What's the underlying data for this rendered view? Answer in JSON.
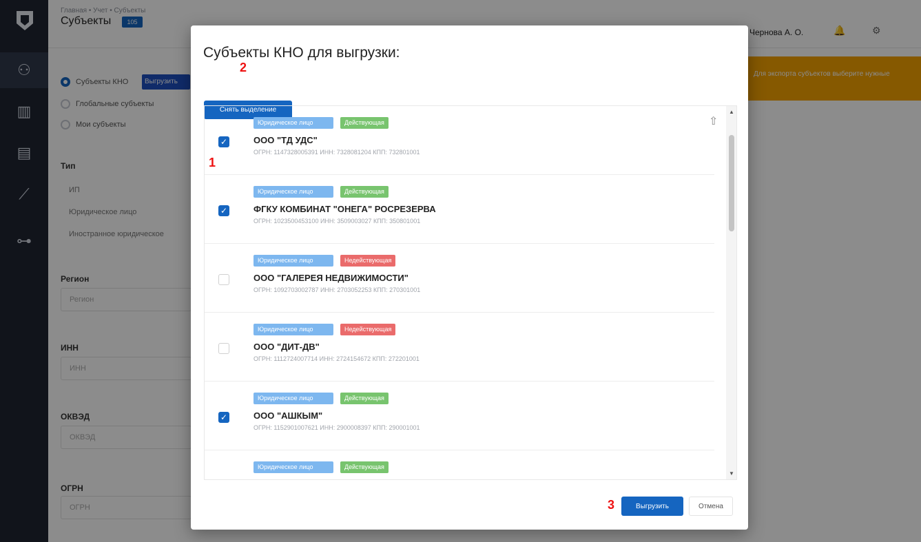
{
  "sidebar": {
    "items": [
      {
        "icon": "users-icon",
        "glyph": "⚇"
      },
      {
        "icon": "building-icon",
        "glyph": "▥"
      },
      {
        "icon": "map-icon",
        "glyph": "▤"
      },
      {
        "icon": "chart-icon",
        "glyph": "⟋"
      },
      {
        "icon": "org-icon",
        "glyph": "⊶"
      }
    ]
  },
  "header": {
    "breadcrumbs": "Главная • Учет • Субъекты",
    "title": "Субъекты",
    "badge": "105",
    "user": "Чернова А. О."
  },
  "banner": {
    "text": "Для экспорта субъектов выберите нужные"
  },
  "filters": {
    "kno_subjects": "Субъекты КНО",
    "export_label": "Выгрузить",
    "global_subjects": "Глобальные субъекты",
    "my_subjects": "Мои субъекты",
    "type_label": "Тип",
    "types": [
      "ИП",
      "Юридическое лицо",
      "Иностранное юридическое"
    ],
    "region_label": "Регион",
    "region_placeholder": "Регион",
    "inn_label": "ИНН",
    "inn_placeholder": "ИНН",
    "okved_label": "ОКВЭД",
    "okved_placeholder": "ОКВЭД",
    "ogrn_label": "ОГРН",
    "ogrn_placeholder": "ОГРН"
  },
  "modal": {
    "title": "Субъекты КНО для выгрузки:",
    "clear_selection": "Снять выделение",
    "submit": "Выгрузить",
    "cancel": "Отмена",
    "annotations": {
      "one": "1",
      "two": "2",
      "three": "3"
    },
    "items": [
      {
        "type": "Юридическое лицо",
        "status": "Действующая",
        "status_kind": "active",
        "checked": true,
        "name": "ООО \"ТД УДС\"",
        "meta": "ОГРН: 1147328005391  ИНН: 7328081204  КПП: 732801001"
      },
      {
        "type": "Юридическое лицо",
        "status": "Действующая",
        "status_kind": "active",
        "checked": true,
        "name": "ФГКУ КОМБИНАТ \"ОНЕГА\" РОСРЕЗЕРВА",
        "meta": "ОГРН: 1023500453100  ИНН: 3509003027  КПП: 350801001"
      },
      {
        "type": "Юридическое лицо",
        "status": "Недействующая",
        "status_kind": "inactive",
        "checked": false,
        "name": "ООО \"ГАЛЕРЕЯ НЕДВИЖИМОСТИ\"",
        "meta": "ОГРН: 1092703002787  ИНН: 2703052253  КПП: 270301001"
      },
      {
        "type": "Юридическое лицо",
        "status": "Недействующая",
        "status_kind": "inactive",
        "checked": false,
        "name": "ООО \"ДИТ-ДВ\"",
        "meta": "ОГРН: 1112724007714  ИНН: 2724154672  КПП: 272201001"
      },
      {
        "type": "Юридическое лицо",
        "status": "Действующая",
        "status_kind": "active",
        "checked": true,
        "name": "ООО \"АШКЫМ\"",
        "meta": "ОГРН: 1152901007621  ИНН: 2900008397  КПП: 290001001"
      },
      {
        "type": "Юридическое лицо",
        "status": "Действующая",
        "status_kind": "active",
        "checked": false,
        "name": "",
        "meta": ""
      }
    ]
  },
  "colors": {
    "accent": "#1565c0",
    "active_tag": "#78c46e",
    "inactive_tag": "#ea6b6b",
    "type_tag": "#7db7ef",
    "annotation": "#ee1111"
  }
}
